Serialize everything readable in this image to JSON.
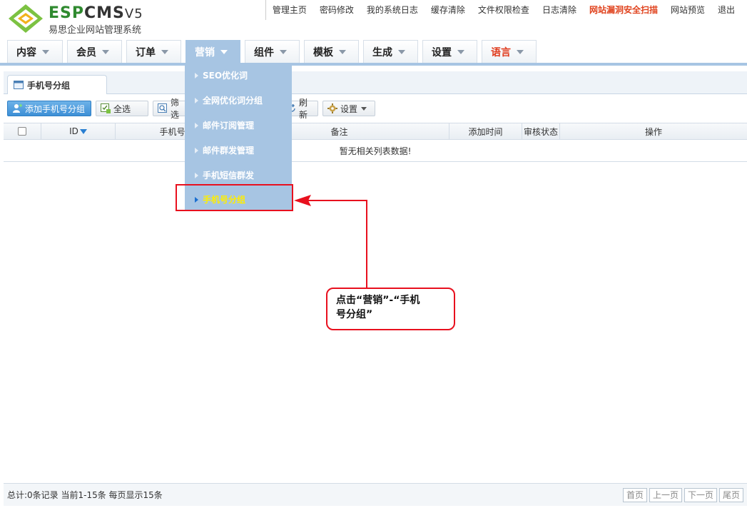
{
  "brand": {
    "name_a": "ESP",
    "name_b": "CMS",
    "version": "V5",
    "subtitle": "易思企业网站管理系统"
  },
  "topnav": [
    {
      "label": "管理主页"
    },
    {
      "label": "密码修改"
    },
    {
      "label": "我的系统日志"
    },
    {
      "label": "缓存清除"
    },
    {
      "label": "文件权限检查"
    },
    {
      "label": "日志清除"
    },
    {
      "label": "网站漏洞安全扫描"
    },
    {
      "label": "网站预览"
    },
    {
      "label": "退出"
    }
  ],
  "mainnav": [
    {
      "label": "内容"
    },
    {
      "label": "会员"
    },
    {
      "label": "订单"
    },
    {
      "label": "营销"
    },
    {
      "label": "组件"
    },
    {
      "label": "模板"
    },
    {
      "label": "生成"
    },
    {
      "label": "设置"
    },
    {
      "label": "语言"
    }
  ],
  "page_tab": {
    "label": "手机号分组"
  },
  "toolbar": {
    "add": "添加手机号分组",
    "select_all": "全选",
    "filter": "筛选",
    "refresh": "刷新",
    "settings": "设置"
  },
  "grid": {
    "headers": {
      "id": "ID",
      "phone": "手机号",
      "note": "备注",
      "added": "添加时间",
      "status": "审核状态",
      "action": "操作"
    },
    "empty": "暂无相关列表数据!"
  },
  "dropdown": [
    {
      "label": "SEO优化词"
    },
    {
      "label": "全网优化词分组"
    },
    {
      "label": "邮件订阅管理"
    },
    {
      "label": "邮件群发管理"
    },
    {
      "label": "手机短信群发"
    },
    {
      "label": "手机号分组"
    }
  ],
  "callout": {
    "line1": "点击“营销”-“手机",
    "line2": "号分组”"
  },
  "footer": {
    "summary": "总计:0条记录 当前1-15条 每页显示15条",
    "pager": {
      "first": "首页",
      "prev": "上一页",
      "next": "下一页",
      "last": "尾页"
    }
  },
  "colors": {
    "accent": "#a7c5e3",
    "highlight": "#e8101e",
    "menu_active_text": "#ffee00",
    "warn_link": "#e0431e"
  }
}
